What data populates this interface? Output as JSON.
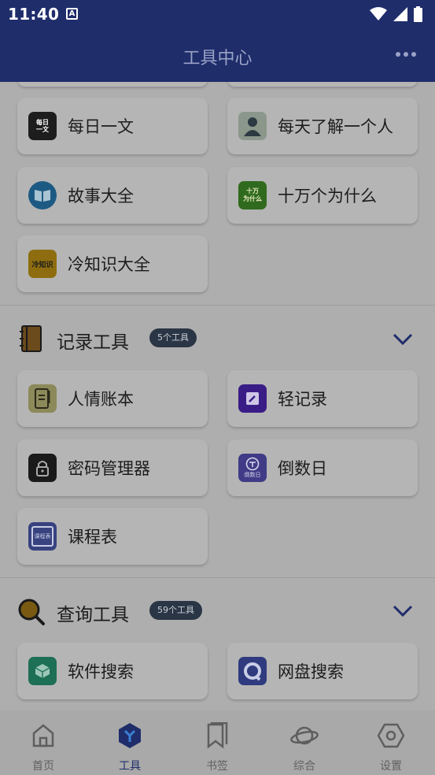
{
  "status_bar": {
    "time": "11:40",
    "notification_badge": "A"
  },
  "app_bar": {
    "title": "工具中心"
  },
  "top_cards": [
    {
      "label": "每日一文",
      "icon": "daily-article-icon",
      "icon_text": "每日\n一文"
    },
    {
      "label": "每天了解一个人",
      "icon": "person-icon"
    },
    {
      "label": "故事大全",
      "icon": "book-icon"
    },
    {
      "label": "十万个为什么",
      "icon": "why-icon",
      "icon_text": "十万\n为什么"
    },
    {
      "label": "冷知识大全",
      "icon": "lightbulb-icon",
      "icon_text": "冷知识"
    }
  ],
  "sections": [
    {
      "title": "记录工具",
      "badge": "5个工具",
      "icon": "notebook-icon",
      "items": [
        {
          "label": "人情账本",
          "icon": "ledger-icon"
        },
        {
          "label": "轻记录",
          "icon": "edit-icon"
        },
        {
          "label": "密码管理器",
          "icon": "lock-icon"
        },
        {
          "label": "倒数日",
          "icon": "countdown-icon",
          "icon_text": "倒数日"
        },
        {
          "label": "课程表",
          "icon": "calendar-icon",
          "icon_text": "课程表"
        }
      ]
    },
    {
      "title": "查询工具",
      "badge": "59个工具",
      "icon": "magnifier-icon",
      "items": [
        {
          "label": "软件搜索",
          "icon": "cube-icon"
        },
        {
          "label": "网盘搜索",
          "icon": "cloud-search-icon"
        }
      ]
    }
  ],
  "bottom_nav": [
    {
      "label": "首页",
      "icon": "home-icon"
    },
    {
      "label": "工具",
      "icon": "tools-icon",
      "active": true
    },
    {
      "label": "书签",
      "icon": "bookmark-icon"
    },
    {
      "label": "综合",
      "icon": "planet-icon"
    },
    {
      "label": "设置",
      "icon": "settings-hexagon-icon"
    }
  ]
}
